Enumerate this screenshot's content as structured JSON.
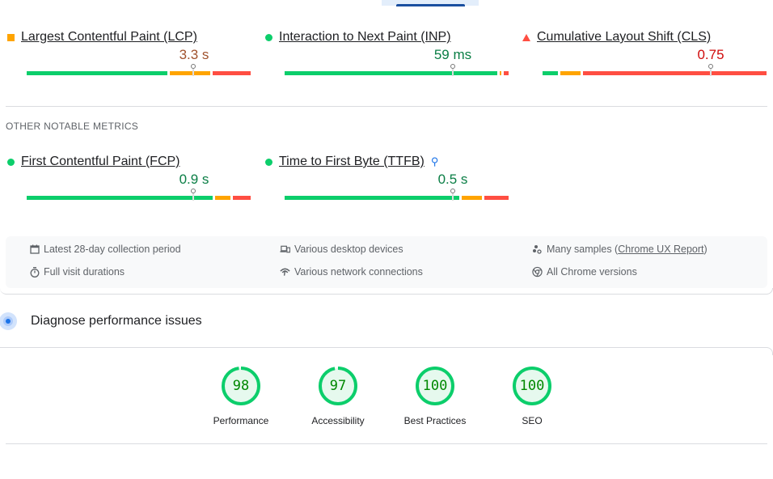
{
  "colors": {
    "good": "#0cce6b",
    "needs_improvement": "#ffa400",
    "poor": "#ff4e42",
    "good_text": "#0a7e45",
    "ni_text": "#a0522d",
    "poor_text": "#d00a0a",
    "accent": "#1a73e8"
  },
  "core_metrics": [
    {
      "name": "Largest Contentful Paint (LCP)",
      "status": "needs-improvement",
      "value": "3.3 s",
      "distribution": {
        "good": 0.64,
        "needs_improvement": 0.19,
        "poor": 0.17
      },
      "percentile_position": 0.745
    },
    {
      "name": "Interaction to Next Paint (INP)",
      "status": "good",
      "value": "59 ms",
      "distribution": {
        "good": 0.96,
        "needs_improvement": 0.02,
        "poor": 0.02
      },
      "percentile_position": 0.75
    },
    {
      "name": "Cumulative Layout Shift (CLS)",
      "status": "poor",
      "value": "0.75",
      "distribution": {
        "good": 0.08,
        "needs_improvement": 0.1,
        "poor": 0.82
      },
      "percentile_position": 0.75
    }
  ],
  "other_section_title": "OTHER NOTABLE METRICS",
  "other_metrics": [
    {
      "name": "First Contentful Paint (FCP)",
      "status": "good",
      "value": "0.9 s",
      "distribution": {
        "good": 0.84,
        "needs_improvement": 0.08,
        "poor": 0.08
      },
      "percentile_position": 0.745
    },
    {
      "name": "Time to First Byte (TTFB)",
      "status": "good",
      "value": "0.5 s",
      "experimental": true,
      "distribution": {
        "good": 0.79,
        "needs_improvement": 0.1,
        "poor": 0.11
      },
      "percentile_position": 0.75
    }
  ],
  "info": [
    {
      "icon": "calendar-icon",
      "text": "Latest 28-day collection period"
    },
    {
      "icon": "devices-icon",
      "text": "Various desktop devices"
    },
    {
      "icon": "samples-icon",
      "text_before": "Many samples (",
      "link": "Chrome UX Report",
      "text_after": ")"
    },
    {
      "icon": "timer-icon",
      "text": "Full visit durations"
    },
    {
      "icon": "network-icon",
      "text": "Various network connections"
    },
    {
      "icon": "chrome-icon",
      "text": "All Chrome versions"
    }
  ],
  "diagnose": {
    "title": "Diagnose performance issues"
  },
  "scores": [
    {
      "label": "Performance",
      "score": "98",
      "fraction": 0.98
    },
    {
      "label": "Accessibility",
      "score": "97",
      "fraction": 0.97
    },
    {
      "label": "Best Practices",
      "score": "100",
      "fraction": 1.0
    },
    {
      "label": "SEO",
      "score": "100",
      "fraction": 1.0
    }
  ]
}
